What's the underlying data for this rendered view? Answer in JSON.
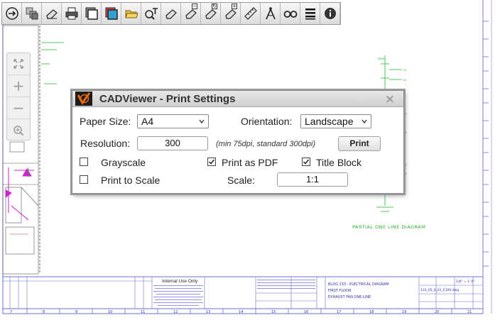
{
  "toolbar": {
    "buttons": [
      {
        "name": "navigate-icon",
        "badge": ""
      },
      {
        "name": "layers-icon",
        "badge": ""
      },
      {
        "name": "print-icon",
        "badge": ""
      },
      {
        "name": "page-view-icon",
        "badge": ""
      },
      {
        "name": "color-page-icon",
        "badge": ""
      },
      {
        "name": "open-folder-icon",
        "badge": ""
      },
      {
        "name": "search-text-icon",
        "badge": ""
      },
      {
        "name": "page-icon",
        "badge": ""
      },
      {
        "name": "page-remove-icon",
        "badge": "−"
      },
      {
        "name": "page-refresh-icon",
        "badge": "↻"
      },
      {
        "name": "page-add-icon",
        "badge": "+"
      },
      {
        "name": "measure-icon",
        "badge": ""
      },
      {
        "name": "compass-icon",
        "badge": ""
      },
      {
        "name": "binoculars-icon",
        "badge": ""
      },
      {
        "name": "menu-icon",
        "badge": ""
      },
      {
        "name": "info-icon",
        "badge": ""
      }
    ]
  },
  "zoom_panel": {
    "buttons": [
      "fit-extents-icon",
      "zoom-in-icon",
      "zoom-out-icon",
      "zoom-window-icon"
    ],
    "plus": "+",
    "minus": "−"
  },
  "dialog": {
    "title": "CADViewer - Print Settings",
    "close": "×",
    "paper_size_label": "Paper Size:",
    "paper_size_value": "A4",
    "orientation_label": "Orientation:",
    "orientation_value": "Landscape",
    "resolution_label": "Resolution:",
    "resolution_value": "300",
    "resolution_hint": "(min 75dpi, standard 300dpi)",
    "print_button": "Print",
    "grayscale_label": "Grayscale",
    "grayscale_checked": false,
    "print_pdf_label": "Print as PDF",
    "print_pdf_checked": true,
    "title_block_label": "Title Block",
    "title_block_checked": true,
    "print_scale_label": "Print to Scale",
    "print_scale_checked": false,
    "scale_label": "Scale:",
    "scale_value": "1:1"
  },
  "drawing": {
    "diagram_label": "PARTIAL ONE LINE DIAGRAM",
    "internal_use": "Internal Use Only",
    "title_lines": [
      "BLDG 133 - ELECTRICAL DIAGRAM",
      "FIRST FLOOR",
      "EXHAUST FAN ONE-LINE"
    ],
    "sheet_scale": "1/8\" = 1'-0\"",
    "sheet_file": "133_05_6_01_E100.dwg",
    "grid_numbers": [
      "7",
      "8",
      "9",
      "10",
      "11",
      "12",
      "13",
      "14",
      "15",
      "16",
      "17",
      "18",
      "19",
      "20",
      "21"
    ]
  }
}
